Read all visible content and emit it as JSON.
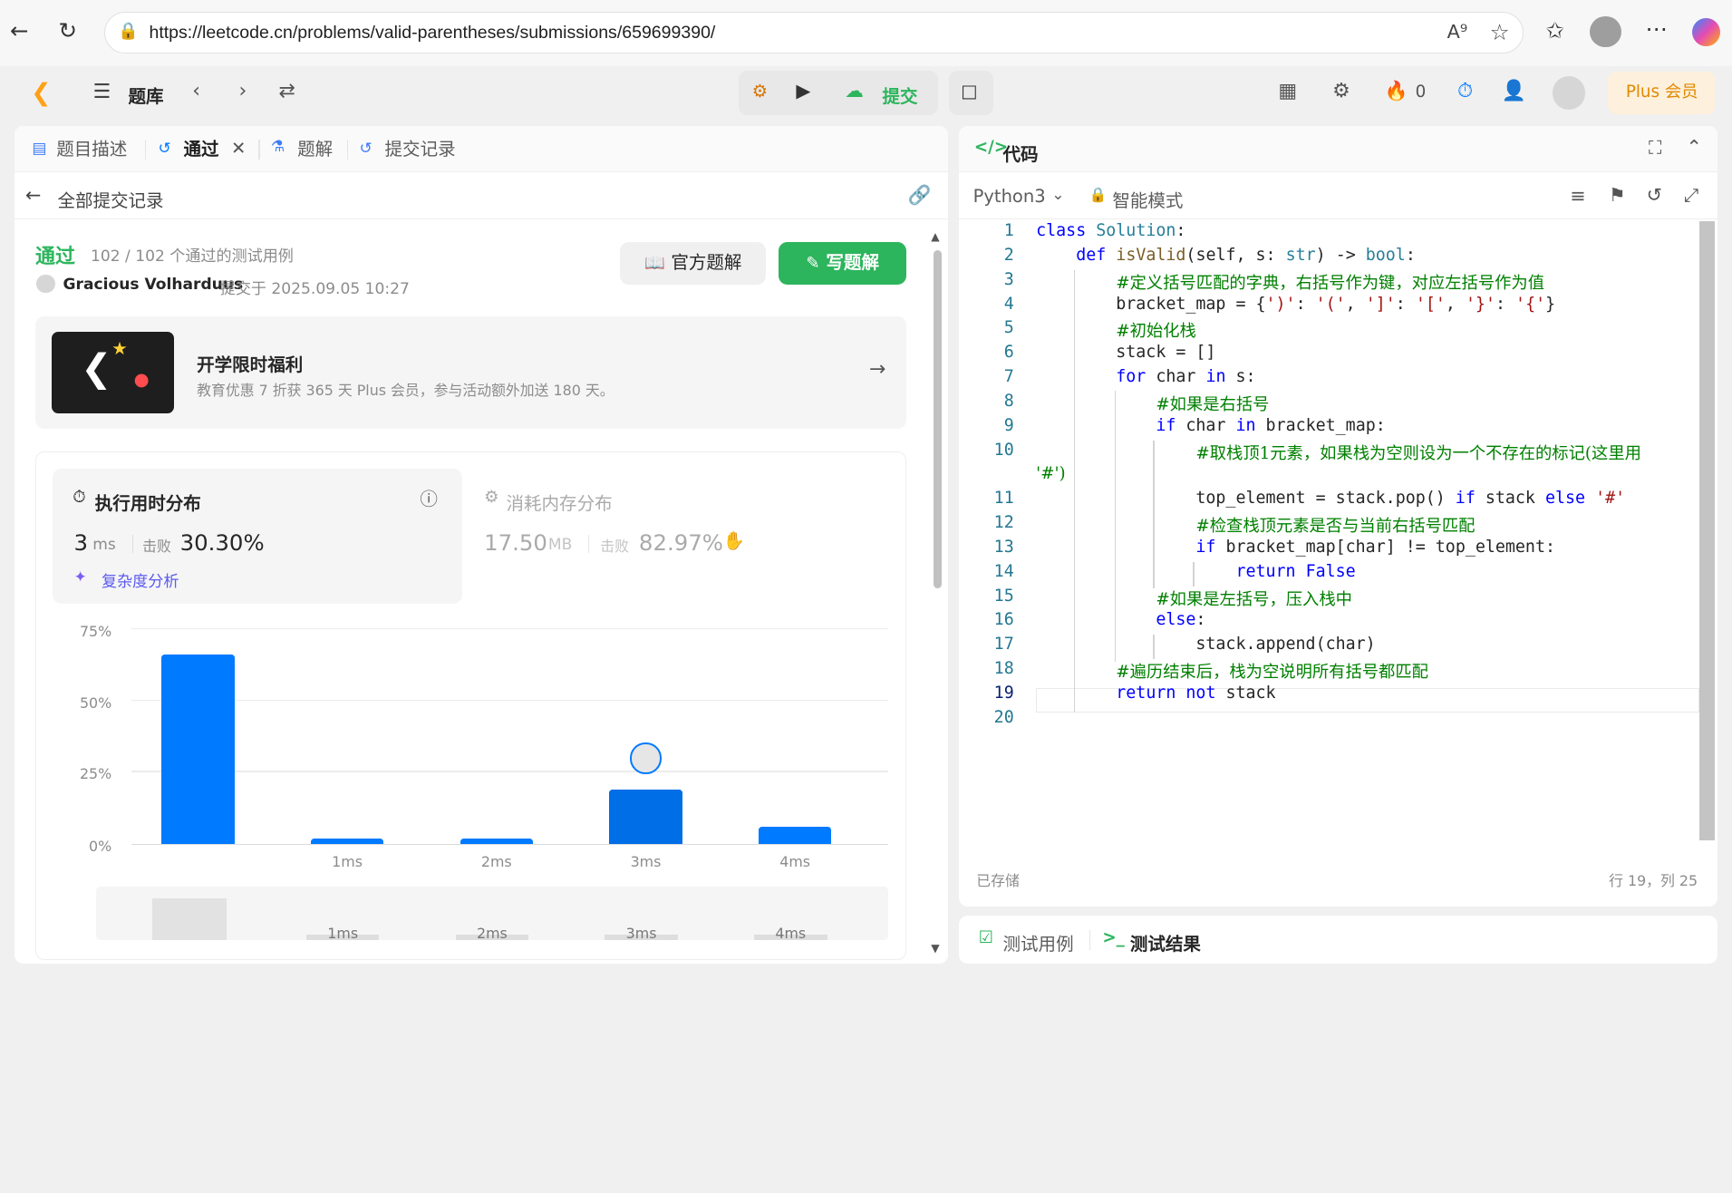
{
  "browser": {
    "url": "https://leetcode.cn/problems/valid-parentheses/submissions/659699390/"
  },
  "topnav": {
    "problem_list": "题库",
    "submit": "提交",
    "fire_count": "0",
    "plus": "Plus 会员"
  },
  "left_tabs": [
    {
      "label": "题目描述"
    },
    {
      "label": "通过"
    },
    {
      "label": "题解"
    },
    {
      "label": "提交记录"
    }
  ],
  "submission": {
    "back_label": "全部提交记录",
    "status": "通过",
    "tests": "102 / 102 个通过的测试用例",
    "user": "Gracious Volharduus",
    "submitted_at": "提交于 2025.09.05 10:27",
    "official_solution": "官方题解",
    "write_solution": "写题解",
    "promo_title": "开学限时福利",
    "promo_desc": "教育优惠 7 折获 365 天 Plus 会员，参与活动额外加送 180 天。",
    "runtime_title": "执行用时分布",
    "runtime_value": "3",
    "runtime_unit": "ms",
    "beats_label": "击败",
    "runtime_beats": "30.30%",
    "complexity": "复杂度分析",
    "memory_title": "消耗内存分布",
    "memory_value": "17.50",
    "memory_unit": "MB",
    "memory_beats": "82.97%"
  },
  "chart_data": {
    "type": "bar",
    "categories": [
      "",
      "1ms",
      "2ms",
      "3ms",
      "4ms"
    ],
    "values": [
      66,
      2,
      2,
      19,
      6
    ],
    "y_ticks": [
      "75%",
      "50%",
      "25%",
      "0%"
    ],
    "ylim": [
      0,
      75
    ],
    "highlight_index": 3,
    "minimap_labels": [
      "1ms",
      "2ms",
      "3ms",
      "4ms"
    ],
    "colors": {
      "bar": "#007aff",
      "highlight": "#006ee6"
    }
  },
  "editor": {
    "title": "代码",
    "language": "Python3",
    "mode": "智能模式",
    "saved": "已存储",
    "cursor": "行 19，列 25",
    "bottom_tabs": [
      "测试用例",
      "测试结果"
    ],
    "line_numbers": [
      "1",
      "2",
      "3",
      "4",
      "5",
      "6",
      "7",
      "8",
      "9",
      "10",
      "",
      "11",
      "12",
      "13",
      "14",
      "15",
      "16",
      "17",
      "18",
      "19",
      "20"
    ]
  }
}
